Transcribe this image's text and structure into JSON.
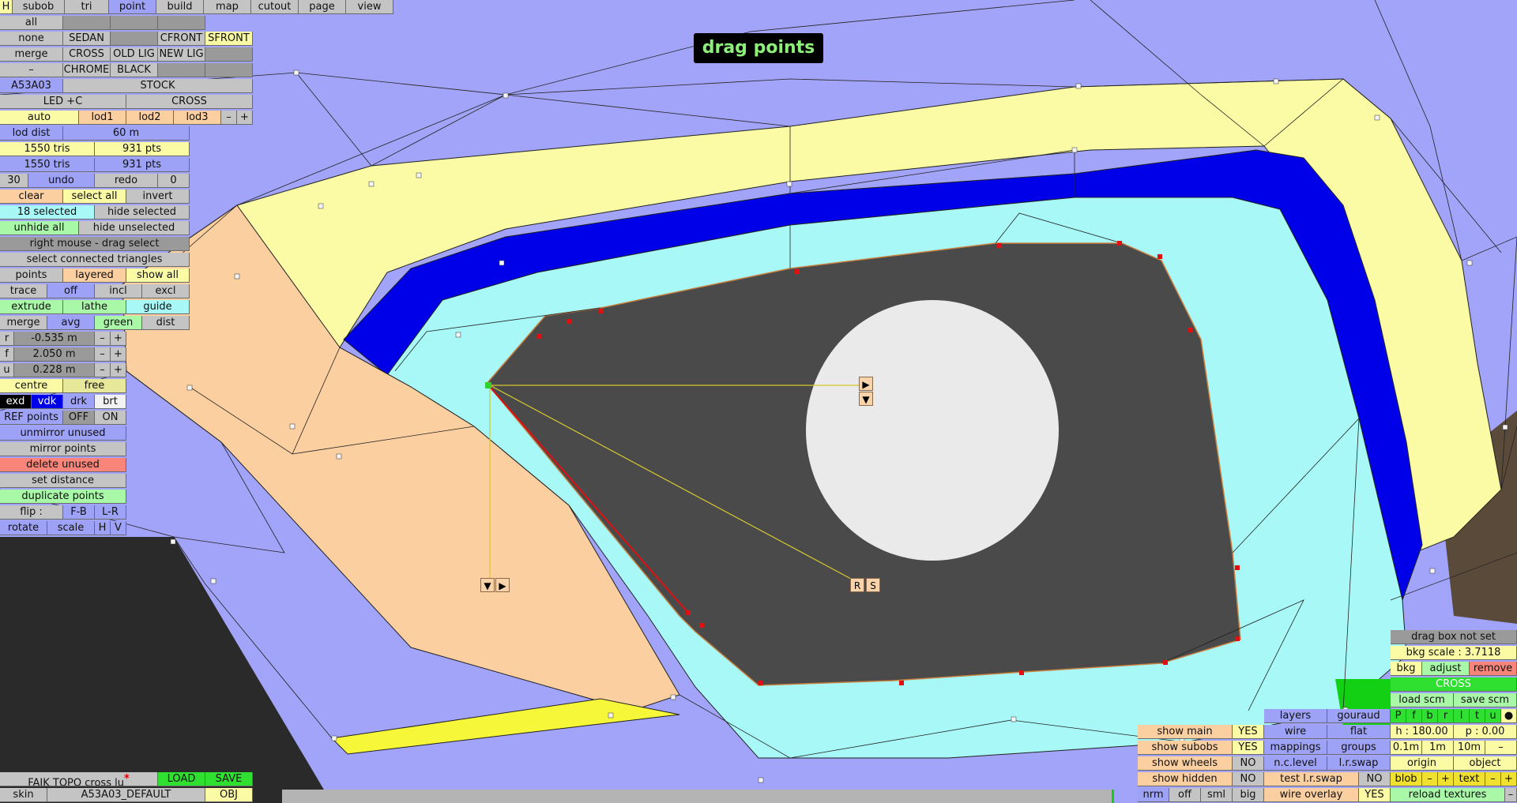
{
  "header": {
    "title": "drag points"
  },
  "top_tabs": [
    "H",
    "subob",
    "tri",
    "point",
    "build",
    "map",
    "cutout",
    "page",
    "view"
  ],
  "rows": {
    "all": "all",
    "none": "none",
    "sedan": "SEDAN",
    "cfront": "CFRONT",
    "sfront": "SFRONT",
    "merge": "merge",
    "cross": "CROSS",
    "old_lig": "OLD LIG",
    "new_lig": "NEW LIG",
    "dash": "–",
    "chrome": "CHROME",
    "black": "BLACK",
    "a53a03": "A53A03",
    "stock": "STOCK",
    "led": "LED +C",
    "cross2": "CROSS",
    "auto": "auto",
    "lod1": "lod1",
    "lod2": "lod2",
    "lod3": "lod3",
    "minus": "–",
    "plus": "+",
    "lod_dist": "lod dist",
    "lod_dist_val": "60 m",
    "tris1": "1550 tris",
    "pts1": "931 pts",
    "tris2": "1550 tris",
    "pts2": "931 pts",
    "n30": "30",
    "undo": "undo",
    "redo": "redo",
    "n0": "0",
    "clear": "clear",
    "select_all": "select all",
    "invert": "invert",
    "selected": "18 selected",
    "hide_selected": "hide selected",
    "unhide_all": "unhide all",
    "hide_unselected": "hide unselected",
    "right_mouse": "right mouse - drag select",
    "select_connected": "select connected triangles",
    "points": "points",
    "layered": "layered",
    "show_all": "show all",
    "trace": "trace",
    "off": "off",
    "incl": "incl",
    "excl": "excl",
    "extrude": "extrude",
    "lathe": "lathe",
    "guide": "guide",
    "merge2": "merge",
    "avg": "avg",
    "green": "green",
    "dist": "dist",
    "r": "r",
    "r_val": "-0.535 m",
    "f": "f",
    "f_val": "2.050 m",
    "u": "u",
    "u_val": "0.228 m",
    "centre": "centre",
    "free": "free",
    "exd": "exd",
    "vdk": "vdk",
    "drk": "drk",
    "brt": "brt",
    "ref_points": "REF points",
    "ref_off": "OFF",
    "ref_on": "ON",
    "unmirror": "unmirror unused",
    "mirror": "mirror points",
    "delete_unused": "delete unused",
    "set_distance": "set distance",
    "duplicate": "duplicate points",
    "flip": "flip :",
    "fb": "F-B",
    "lr": "L-R",
    "rotate": "rotate",
    "scale": "scale",
    "h": "H",
    "v": "V"
  },
  "bottom_left": {
    "file": "FAIK TOPO cross lu",
    "file_mark": "*",
    "load": "LOAD",
    "save": "SAVE",
    "skin": "skin",
    "skin_name": "A53A03_DEFAULT",
    "obj": "OBJ"
  },
  "handles": {
    "arrow_r": "▶",
    "arrow_d": "▼",
    "R": "R",
    "S": "S"
  },
  "bottom_mid": {
    "show_main": "show main",
    "show_main_v": "YES",
    "show_subobs": "show subobs",
    "show_subobs_v": "YES",
    "show_wheels": "show wheels",
    "show_wheels_v": "NO",
    "show_hidden": "show hidden",
    "show_hidden_v": "NO",
    "nrm": "nrm",
    "off": "off",
    "sml": "sml",
    "big": "big",
    "layers": "layers",
    "gouraud": "gouraud",
    "wire": "wire",
    "flat": "flat",
    "mappings": "mappings",
    "groups": "groups",
    "nclevel": "n.c.level",
    "lrswap": "l.r.swap",
    "test_lrswap": "test l.r.swap",
    "test_lrswap_v": "NO",
    "wire_overlay": "wire overlay",
    "wire_overlay_v": "YES"
  },
  "bottom_right": {
    "drag_box": "drag box not set",
    "bkg_scale": "bkg scale : 3.7118",
    "bkg": "bkg",
    "adjust": "adjust",
    "remove": "remove",
    "cross": "CROSS",
    "load_scm": "load scm",
    "save_scm": "save scm",
    "letters": [
      "P",
      "f",
      "b",
      "r",
      "l",
      "t",
      "u",
      "●"
    ],
    "h": "h : 180.00",
    "p": "p : 0.00",
    "s01": "0.1m",
    "s1": "1m",
    "s10": "10m",
    "sdash": "–",
    "origin": "origin",
    "object": "object",
    "blob": "blob",
    "bm": "–",
    "bp": "+",
    "text": "text",
    "tm": "–",
    "tp": "+",
    "reload": "reload textures",
    "rm": "–"
  },
  "colors": {
    "background": "#a1a4f8",
    "yellow": "#fbfba6",
    "blue": "#0000e8",
    "cyan": "#a8f8f8",
    "peach": "#fbcfa0"
  }
}
